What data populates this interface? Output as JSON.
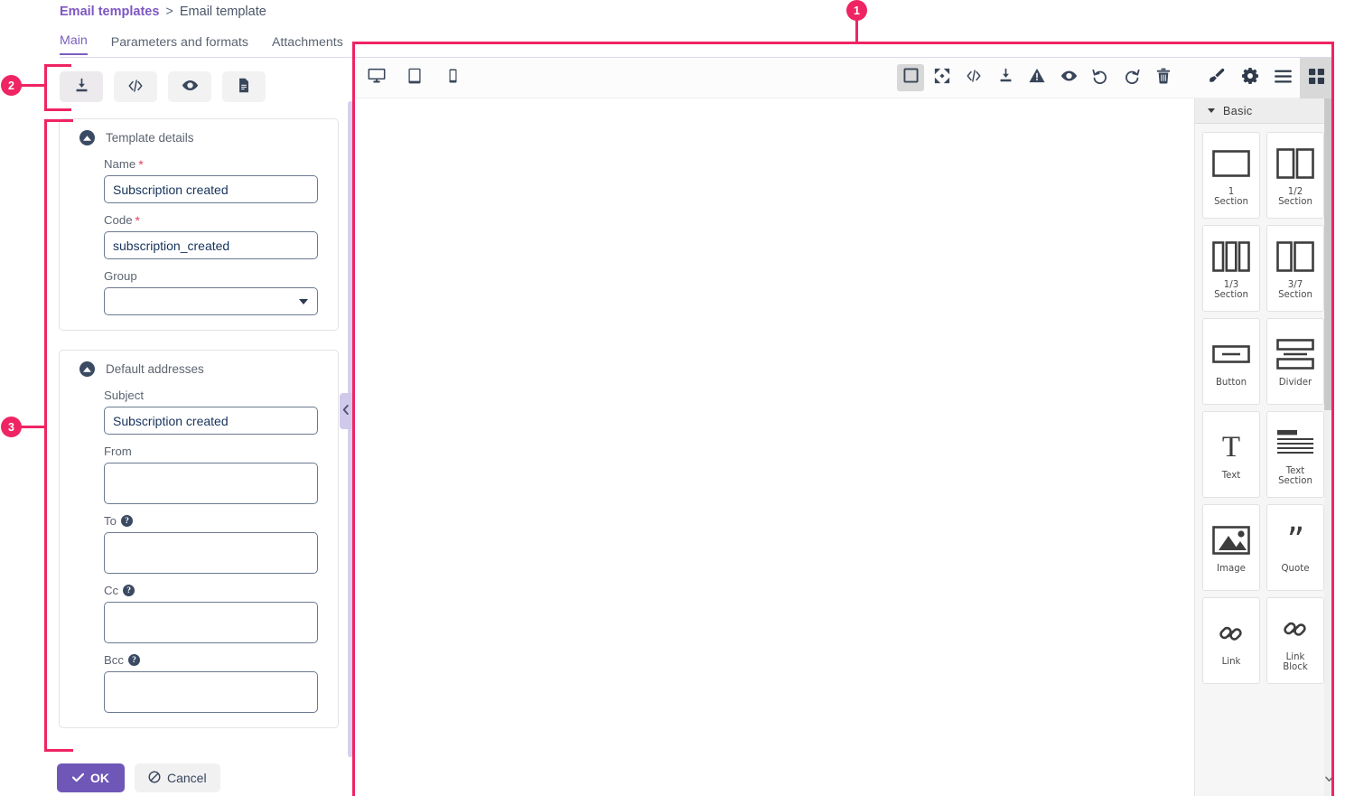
{
  "breadcrumb": {
    "parent": "Email templates",
    "separator": ">",
    "current": "Email template"
  },
  "tabs": [
    {
      "label": "Main",
      "active": true
    },
    {
      "label": "Parameters and formats",
      "active": false
    },
    {
      "label": "Attachments",
      "active": false
    }
  ],
  "left_toolbar": [
    {
      "name": "import-template-button",
      "icon": "download-tray-icon"
    },
    {
      "name": "source-code-button",
      "icon": "code-icon"
    },
    {
      "name": "preview-button",
      "icon": "eye-icon"
    },
    {
      "name": "document-button",
      "icon": "document-icon"
    }
  ],
  "form": {
    "template_details": {
      "title": "Template details",
      "fields": [
        {
          "label": "Name",
          "required": true,
          "value": "Subscription created",
          "type": "text",
          "name": "name-field"
        },
        {
          "label": "Code",
          "required": true,
          "value": "subscription_created",
          "type": "text",
          "name": "code-field"
        },
        {
          "label": "Group",
          "required": false,
          "value": "",
          "type": "select",
          "name": "group-select"
        }
      ]
    },
    "default_addresses": {
      "title": "Default addresses",
      "fields": [
        {
          "label": "Subject",
          "required": false,
          "help": false,
          "value": "Subscription created",
          "type": "text",
          "name": "subject-field"
        },
        {
          "label": "From",
          "required": false,
          "help": false,
          "value": "",
          "type": "text",
          "name": "from-field"
        },
        {
          "label": "To",
          "required": false,
          "help": true,
          "value": "",
          "type": "textarea",
          "name": "to-field"
        },
        {
          "label": "Cc",
          "required": false,
          "help": true,
          "value": "",
          "type": "textarea",
          "name": "cc-field"
        },
        {
          "label": "Bcc",
          "required": false,
          "help": true,
          "value": "",
          "type": "textarea",
          "name": "bcc-field"
        }
      ]
    },
    "help_glyph": "?"
  },
  "footer": {
    "ok_label": "OK",
    "ok_icon": "check-icon",
    "cancel_label": "Cancel",
    "cancel_icon": "ban-icon"
  },
  "editor": {
    "devices": [
      {
        "name": "desktop-view-button",
        "icon": "desktop-icon",
        "active": false
      },
      {
        "name": "tablet-view-button",
        "icon": "tablet-icon",
        "active": false
      },
      {
        "name": "mobile-view-button",
        "icon": "mobile-icon",
        "active": false
      }
    ],
    "center_tools": [
      {
        "name": "borders-toggle-button",
        "icon": "square-outline-icon",
        "active": true
      },
      {
        "name": "fullscreen-button",
        "icon": "expand-arrows-icon",
        "active": false
      },
      {
        "name": "view-code-button",
        "icon": "code-icon",
        "active": false
      },
      {
        "name": "import-button",
        "icon": "download-tray-icon",
        "active": false
      },
      {
        "name": "warning-button",
        "icon": "warning-triangle-icon",
        "active": false
      },
      {
        "name": "preview-button",
        "icon": "eye-icon",
        "active": false
      },
      {
        "name": "undo-button",
        "icon": "undo-icon",
        "active": false
      },
      {
        "name": "redo-button",
        "icon": "redo-icon",
        "active": false
      },
      {
        "name": "clear-canvas-button",
        "icon": "trash-icon",
        "active": false
      }
    ],
    "right_tools": [
      {
        "name": "style-manager-button",
        "icon": "paint-brush-icon",
        "active": false
      },
      {
        "name": "settings-button",
        "icon": "gear-icon",
        "active": false
      },
      {
        "name": "layer-manager-button",
        "icon": "hamburger-icon",
        "active": false
      },
      {
        "name": "blocks-button",
        "icon": "grid-blocks-icon",
        "active": true
      }
    ]
  },
  "blocks_panel": {
    "category": "Basic",
    "collapse_icon": "triangle-down-icon",
    "scroll_down_icon": "chevron-down-icon",
    "blocks": [
      {
        "label": "1\nSection",
        "icon": "one-section-icon",
        "name": "block-1-section"
      },
      {
        "label": "1/2\nSection",
        "icon": "half-section-icon",
        "name": "block-half-section"
      },
      {
        "label": "1/3\nSection",
        "icon": "third-section-icon",
        "name": "block-third-section"
      },
      {
        "label": "3/7\nSection",
        "icon": "three-seven-section-icon",
        "name": "block-three-seven-section"
      },
      {
        "label": "Button",
        "icon": "button-icon",
        "name": "block-button"
      },
      {
        "label": "Divider",
        "icon": "divider-icon",
        "name": "block-divider"
      },
      {
        "label": "Text",
        "icon": "text-t-icon",
        "name": "block-text"
      },
      {
        "label": "Text\nSection",
        "icon": "text-section-icon",
        "name": "block-text-section"
      },
      {
        "label": "Image",
        "icon": "image-icon",
        "name": "block-image"
      },
      {
        "label": "Quote",
        "icon": "quote-icon",
        "name": "block-quote"
      },
      {
        "label": "Link",
        "icon": "link-icon",
        "name": "block-link"
      },
      {
        "label": "Link\nBlock",
        "icon": "link-block-icon",
        "name": "block-link-block"
      }
    ]
  },
  "annotations": [
    {
      "number": "1",
      "name": "annotation-marker-1"
    },
    {
      "number": "2",
      "name": "annotation-marker-2"
    },
    {
      "number": "3",
      "name": "annotation-marker-3"
    }
  ],
  "colors": {
    "accent_purple": "#7b5fc0",
    "annotation_pink": "#ef2463",
    "required_red": "#e4445e",
    "input_border": "#6b7a90",
    "input_text": "#16335c"
  },
  "collapse_panel_icon": "chevron-left-icon"
}
